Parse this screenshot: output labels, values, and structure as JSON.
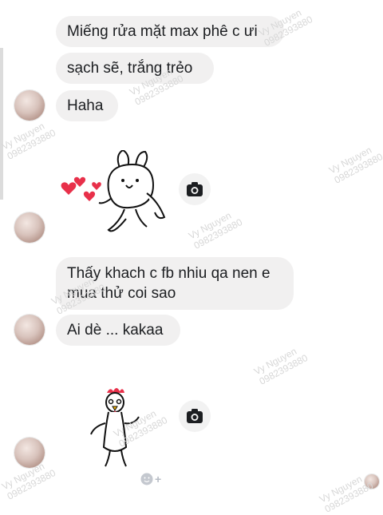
{
  "messages": [
    {
      "text": "Miếng rửa mặt max phê c ưi"
    },
    {
      "text": "sạch sẽ, trắng trẻo"
    },
    {
      "text": "Haha"
    },
    {
      "text": "Thấy khach c fb nhiu qa nen e"
    },
    {
      "text": "mua thử coi sao"
    },
    {
      "text": "Ai dè ... kakaa"
    }
  ],
  "watermark": {
    "name": "Vy Nguyen",
    "phone": "0982393880"
  },
  "icons": {
    "camera": "camera-icon",
    "reaction": "smiley-plus-icon",
    "sticker_rabbit": "rabbit-hearts-sticker",
    "sticker_chicken": "chicken-sticker"
  },
  "colors": {
    "bubble": "#f1f0f0",
    "text": "#1c1e21",
    "heart": "#e8304a"
  }
}
